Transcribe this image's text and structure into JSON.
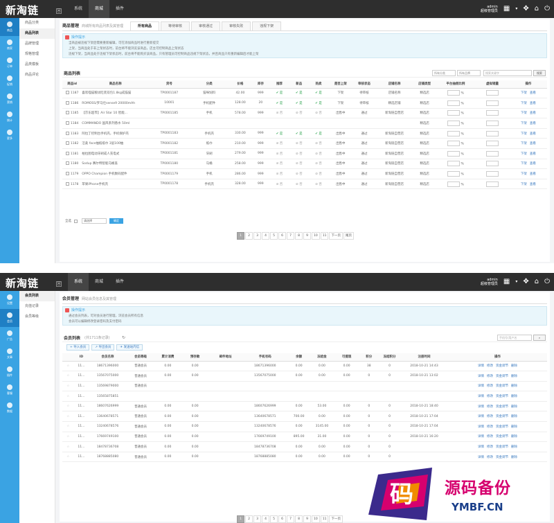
{
  "common": {
    "logo": "新淘链",
    "logo_sub": "回",
    "nav_items": [
      "系统",
      "商城",
      "插件"
    ],
    "active_nav": 1,
    "admin_name": "admin",
    "admin_role": "超级管理员",
    "icons": {
      "right": [
        "calendar-icon",
        "chevron-down-icon",
        "expand-icon",
        "home-icon",
        "power-icon"
      ]
    }
  },
  "shot1": {
    "sidebar": [
      "商品",
      "商家",
      "订单",
      "促销",
      "营销",
      "统计",
      "更多"
    ],
    "active_sidebar": 0,
    "subside": [
      "商品分类",
      "商品列表",
      "品牌管理",
      "规格管理",
      "品类模板",
      "商品评论"
    ],
    "active_subside": 1,
    "tab_title": "商品管理",
    "tab_desc": "商城所有商品列表及其管理",
    "tabs": [
      "所有商品",
      "等待审核",
      "审核通过",
      "审核失败",
      "违规下架"
    ],
    "active_tab": 0,
    "tip_head": "操作提示",
    "tips": [
      "当商品被违规下架后需要重新编辑，可在添加商品时进行重新提交",
      "上架，当商品处于非上架状态时，前台将不能浏览该商品，店主可控制商品上架状态",
      "违规下架，当商品处于违规下架状态时，前台将不能购买该商品，只有管理员可控制商品违规下架状态，并且商品只有重新编辑后才能上架"
    ],
    "list_title": "商品列表",
    "filter1": "所有分类",
    "filter2": "所有品牌",
    "search_placeholder": "搜索关键字",
    "search_btn": "搜索",
    "columns": [
      "商品id",
      "商品名称",
      "货号",
      "分类",
      "价格",
      "库存",
      "推荐",
      "新品",
      "热卖",
      "是否上架",
      "审核状态",
      "店铺名称",
      "店铺类型",
      "平台抽佣比例",
      "虚拟销量",
      "操作"
    ],
    "rows": [
      [
        "1187",
        "喜欢喵猫粮试吃装双包1.8kg成猫猫",
        "TP0001187",
        "猫咪饲料",
        "42.00",
        "999",
        "是",
        "是",
        "是",
        "下架",
        "待审核",
        "店铺名称",
        "精选店"
      ],
      [
        "1186",
        "ROMOSS/罗马仕sense9 20000mAh",
        "10001",
        "手机配件",
        "128.00",
        "20",
        "是",
        "是",
        "是",
        "下架",
        "待审核",
        "精选店铺",
        "精选店"
      ],
      [
        "1185",
        "【京东超市】Air Star 10 智能...",
        "TP0001185",
        "手机",
        "578.00",
        "999",
        "否",
        "否",
        "否",
        "出售中",
        "通过",
        "新淘链自营店",
        "精选店"
      ],
      [
        "1184",
        "COMMANDO 国风系列香水 50ml",
        "",
        "",
        "",
        "",
        "",
        "",
        "",
        "",
        "",
        "",
        "精选店"
      ],
      [
        "1183",
        "阿拉丁控制台手机壳，手机保护壳",
        "TP0001183",
        "手机壳",
        "330.00",
        "999",
        "是",
        "是",
        "是",
        "出售中",
        "通过",
        "新淘链自营店",
        "精选店"
      ],
      [
        "1182",
        "洁柔 face抽纸纸巾 3层100抽",
        "TP0001182",
        "纸巾",
        "210.00",
        "999",
        "否",
        "否",
        "否",
        "出售中",
        "通过",
        "新淘链自营店",
        "精选店"
      ],
      [
        "1181",
        "柏拉图电动牙刷成人充电式",
        "TP0001181",
        "牙刷",
        "279.00",
        "999",
        "否",
        "否",
        "否",
        "出售中",
        "通过",
        "新淘链自营店",
        "精选店"
      ],
      [
        "1180",
        "Sodup 赛尔特智能马桶盖",
        "TP0001180",
        "马桶",
        "258.00",
        "999",
        "否",
        "否",
        "否",
        "出售中",
        "通过",
        "新淘链自营店",
        "精选店"
      ],
      [
        "1179",
        "OPPO Champion 手机数码配件",
        "TP0001179",
        "手机",
        "286.00",
        "999",
        "否",
        "否",
        "否",
        "出售中",
        "通过",
        "新淘链自营店",
        "精选店"
      ],
      [
        "1178",
        "苹果iPhone手机壳",
        "TP0001178",
        "手机壳",
        "328.00",
        "999",
        "否",
        "否",
        "否",
        "出售中",
        "通过",
        "新淘链自营店",
        "精选店"
      ]
    ],
    "row_actions": [
      "下架",
      "查看"
    ],
    "bottom_label": "全选",
    "bottom_select": "请选择",
    "bottom_btn": "确定",
    "pages": [
      "1",
      "2",
      "3",
      "4",
      "5",
      "6",
      "7",
      "8",
      "9",
      "10",
      "11",
      "下一页",
      "尾页"
    ],
    "active_page": 0
  },
  "shot2": {
    "sidebar": [
      "设置",
      "会员",
      "广告",
      "文章",
      "插件",
      "客服",
      "数据"
    ],
    "active_sidebar": 1,
    "subside": [
      "会员列表",
      "充值记录",
      "会员等级"
    ],
    "active_subside": 0,
    "tab_title": "会员管理",
    "tab_desc": "网站会员信息及其管理",
    "tip_head": "操作提示",
    "tips": [
      "通过会员列表，可对会员进行管理，浏览会员所有信息",
      "会员可以编辑修改登录密码及支付密码"
    ],
    "list_title": "会员列表",
    "list_count": "(共1711条记录)",
    "search_placeholder": "手机号/用户名",
    "btns": [
      "导入会员",
      "导出会员",
      "发送站内信"
    ],
    "columns": [
      "",
      "ID",
      "会员名称",
      "会员等级",
      "累计消费",
      "预存款",
      "邮件地址",
      "手机号码",
      "余额",
      "冻结金",
      "可提现",
      "积分",
      "冻结积分",
      "注册时间",
      "操作"
    ],
    "rows": [
      [
        "11...",
        "18671396000",
        "普通会员",
        "0.00",
        "0.00",
        "",
        "18671396000",
        "0.00",
        "0.00",
        "0.00",
        "38",
        "0",
        "2018-10-21 14:43"
      ],
      [
        "11...",
        "13567075000",
        "普通会员",
        "0.00",
        "0.00",
        "",
        "13567075000",
        "0.00",
        "0.00",
        "0.00",
        "0",
        "0",
        "2018-10-21 13:02"
      ],
      [
        "11...",
        "13569879000",
        "普通会员",
        "",
        "",
        "",
        "",
        "",
        "",
        "",
        "",
        "",
        ""
      ],
      [
        "11...",
        "13565875851",
        "",
        "",
        "",
        "",
        "",
        "",
        "",
        "",
        "",
        "",
        ""
      ],
      [
        "11...",
        "18607626999",
        "普通会员",
        "0.00",
        "0.00",
        "",
        "18607626999",
        "0.00",
        "53.00",
        "0.00",
        "0",
        "0",
        "2018-10-21 18:40"
      ],
      [
        "11...",
        "13640678571",
        "普通会员",
        "0.00",
        "0.00",
        "",
        "13640678571",
        "700.00",
        "0.00",
        "0.00",
        "0",
        "0",
        "2018-10-21 17:04"
      ],
      [
        "11...",
        "13240678576",
        "普通会员",
        "0.00",
        "0.00",
        "",
        "13240678576",
        "0.00",
        "3145.00",
        "0.00",
        "0",
        "0",
        "2018-10-21 17:04"
      ],
      [
        "11...",
        "17669749100",
        "普通会员",
        "0.00",
        "0.00",
        "",
        "17669749100",
        "895.00",
        "31.00",
        "0.00",
        "0",
        "0",
        "2018-10-21 16:20"
      ],
      [
        "11...",
        "18478736708",
        "普通会员",
        "0.00",
        "0.00",
        "",
        "18478736708",
        "0.00",
        "0.00",
        "0.00",
        "0",
        "0",
        ""
      ],
      [
        "11...",
        "18768885080",
        "普通会员",
        "0.00",
        "0.00",
        "",
        "18768885080",
        "0.00",
        "0.00",
        "0.00",
        "0",
        "0",
        ""
      ]
    ],
    "row_actions": [
      "详情",
      "修改",
      "资金调节",
      "删除"
    ],
    "pages": [
      "1",
      "2",
      "3",
      "4",
      "5",
      "6",
      "7",
      "8",
      "9",
      "10",
      "11",
      "下一页"
    ],
    "active_page": 0
  },
  "watermark": {
    "tile_char": "码",
    "text": "源码备份",
    "url": "YMBF.CN"
  }
}
